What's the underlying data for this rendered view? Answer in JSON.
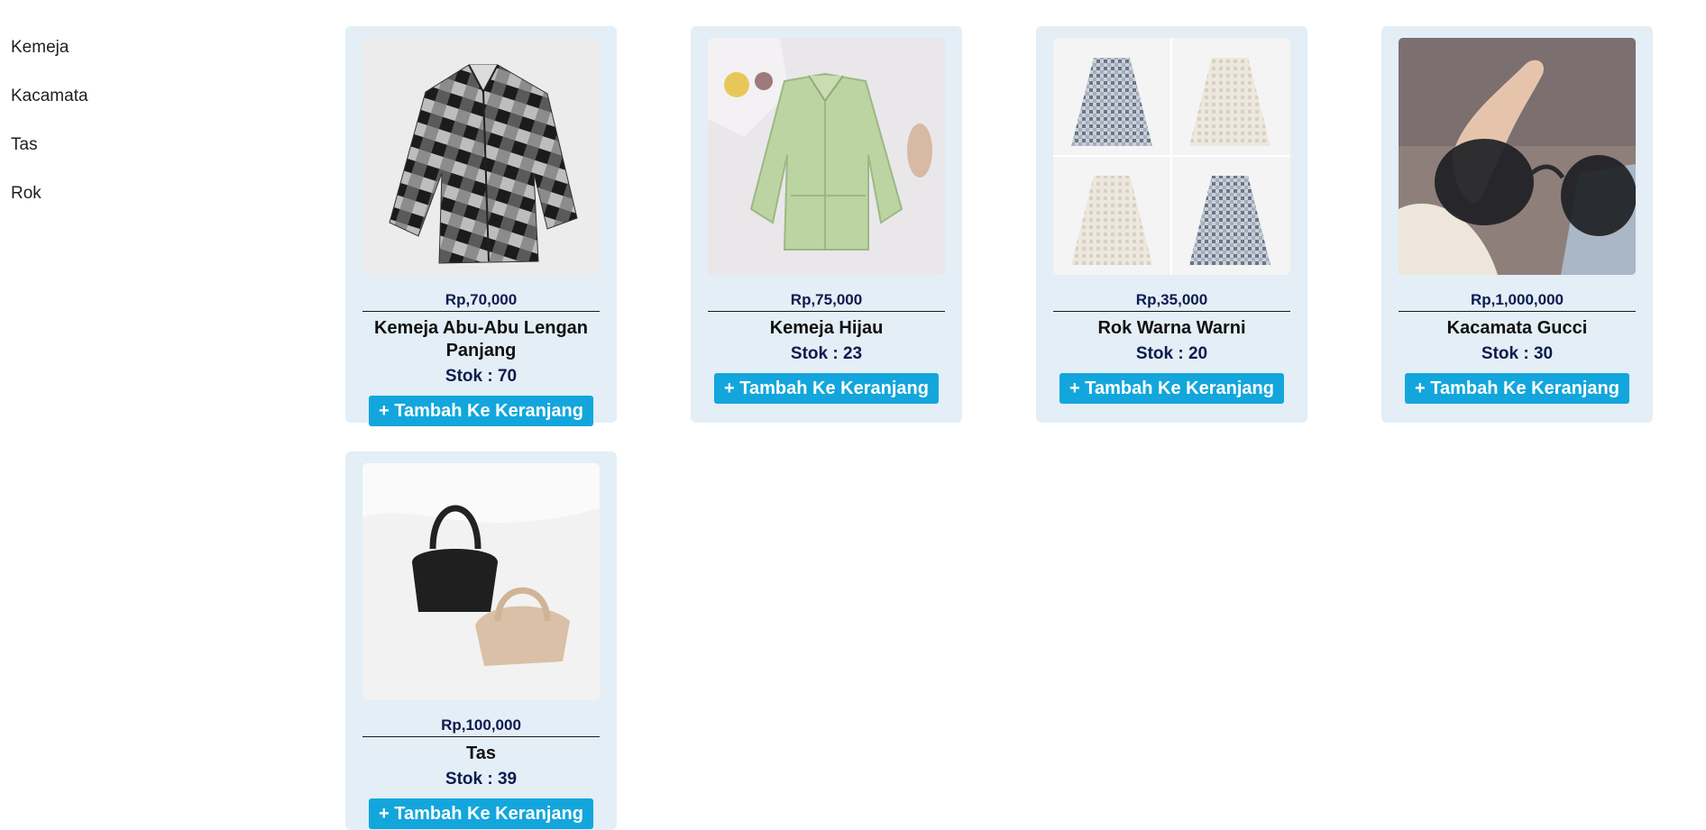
{
  "categories": [
    {
      "label": "Kemeja"
    },
    {
      "label": "Kacamata"
    },
    {
      "label": "Tas"
    },
    {
      "label": "Rok"
    }
  ],
  "products": [
    {
      "price": "Rp,70,000",
      "name": "Kemeja Abu-Abu Lengan Panjang",
      "stock": "Stok : 70",
      "button": "+ Tambah Ke Keranjang",
      "image": "plaid-shirt-photo"
    },
    {
      "price": "Rp,75,000",
      "name": "Kemeja Hijau",
      "stock": "Stok : 23",
      "button": "+ Tambah Ke Keranjang",
      "image": "green-blouse-photo"
    },
    {
      "price": "Rp,35,000",
      "name": "Rok Warna Warni",
      "stock": "Stok : 20",
      "button": "+ Tambah Ke Keranjang",
      "image": "skirts-photo"
    },
    {
      "price": "Rp,1,000,000",
      "name": "Kacamata Gucci",
      "stock": "Stok : 30",
      "button": "+ Tambah Ke Keranjang",
      "image": "sunglasses-photo"
    },
    {
      "price": "Rp,100,000",
      "name": "Tas",
      "stock": "Stok : 39",
      "button": "+ Tambah Ke Keranjang",
      "image": "handbags-photo"
    }
  ],
  "colors": {
    "card_bg": "#e3eef6",
    "button_bg": "#13a6dc",
    "price_text": "#0d1b4d"
  }
}
